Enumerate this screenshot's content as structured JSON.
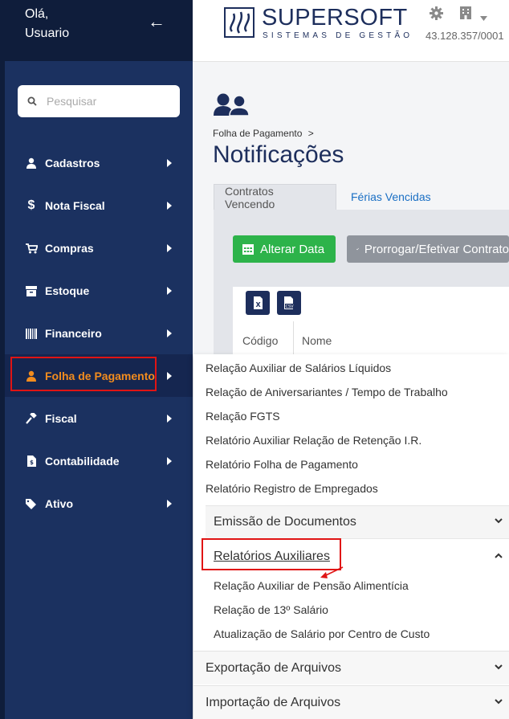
{
  "sidebar": {
    "greeting_line1": "Olá,",
    "greeting_line2": "Usuario",
    "search_placeholder": "Pesquisar",
    "items": [
      {
        "label": "Cadastros",
        "icon": "user-icon"
      },
      {
        "label": "Nota Fiscal",
        "icon": "dollar-icon"
      },
      {
        "label": "Compras",
        "icon": "cart-icon"
      },
      {
        "label": "Estoque",
        "icon": "box-icon"
      },
      {
        "label": "Financeiro",
        "icon": "barcode-icon"
      },
      {
        "label": "Folha de Pagamento",
        "icon": "user-icon",
        "active": true
      },
      {
        "label": "Fiscal",
        "icon": "gavel-icon"
      },
      {
        "label": "Contabilidade",
        "icon": "document-icon"
      },
      {
        "label": "Ativo",
        "icon": "tags-icon"
      }
    ]
  },
  "header": {
    "logo_name": "SUPERSOFT",
    "logo_tagline": "SISTEMAS DE GESTÃO",
    "cnpj": "43.128.357/0001"
  },
  "page": {
    "breadcrumb": "Folha de Pagamento",
    "breadcrumb_sep": ">",
    "title": "Notificações",
    "tabs": [
      {
        "label": "Contratos Vencendo",
        "active": true
      },
      {
        "label": "Férias Vencidas",
        "active": false
      }
    ],
    "buttons": {
      "alterar_data": "Alterar Data",
      "prorrogar": "Prorrogar/Efetivar Contrato"
    },
    "table_headers": [
      "Código",
      "Nome"
    ]
  },
  "dropdown": {
    "items": [
      "Relação Auxiliar de Salários Líquidos",
      "Relação de Aniversariantes / Tempo de Trabalho",
      "Relação FGTS",
      "Relatório Auxiliar Relação de Retenção I.R.",
      "Relatório Folha de Pagamento",
      "Relatório Registro de Empregados"
    ],
    "section_emissao": "Emissão de Documentos",
    "section_relatorios": "Relatórios Auxiliares",
    "relatorios_items": [
      "Relação Auxiliar de Pensão Alimentícia",
      "Relação de 13º Salário",
      "Atualização de Salário por Centro de Custo"
    ],
    "section_exportacao": "Exportação de Arquivos",
    "section_importacao": "Importação de Arquivos"
  },
  "colors": {
    "sidebar": "#1b3160",
    "sidebar_dark": "#0f1d3b",
    "accent_orange": "#f28c1e",
    "green": "#2db34a",
    "highlight_red": "#e01414"
  }
}
